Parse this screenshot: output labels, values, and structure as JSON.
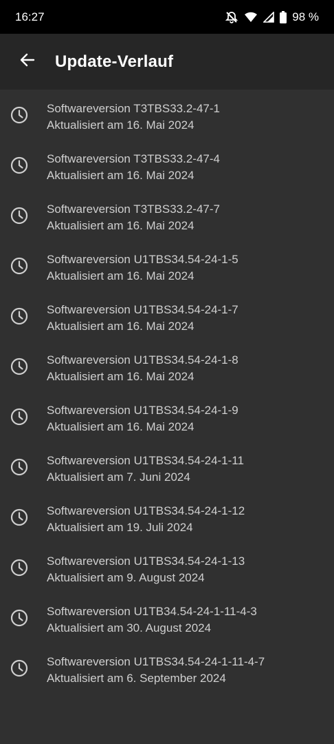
{
  "status_bar": {
    "time": "16:27",
    "battery_text": "98 %",
    "icons": [
      "mute-icon",
      "wifi-icon",
      "signal-icon",
      "battery-icon"
    ]
  },
  "app_bar": {
    "title": "Update-Verlauf",
    "back_icon": "arrow-back-icon"
  },
  "history": [
    {
      "version": "Softwareversion T3TBS33.2-47-1",
      "date": "Aktualisiert am 16. Mai 2024"
    },
    {
      "version": "Softwareversion T3TBS33.2-47-4",
      "date": "Aktualisiert am 16. Mai 2024"
    },
    {
      "version": "Softwareversion T3TBS33.2-47-7",
      "date": "Aktualisiert am 16. Mai 2024"
    },
    {
      "version": "Softwareversion U1TBS34.54-24-1-5",
      "date": "Aktualisiert am 16. Mai 2024"
    },
    {
      "version": "Softwareversion U1TBS34.54-24-1-7",
      "date": "Aktualisiert am 16. Mai 2024"
    },
    {
      "version": "Softwareversion U1TBS34.54-24-1-8",
      "date": "Aktualisiert am 16. Mai 2024"
    },
    {
      "version": "Softwareversion U1TBS34.54-24-1-9",
      "date": "Aktualisiert am 16. Mai 2024"
    },
    {
      "version": "Softwareversion U1TBS34.54-24-1-11",
      "date": "Aktualisiert am 7. Juni 2024"
    },
    {
      "version": "Softwareversion U1TBS34.54-24-1-12",
      "date": "Aktualisiert am 19. Juli 2024"
    },
    {
      "version": "Softwareversion U1TBS34.54-24-1-13",
      "date": "Aktualisiert am 9. August 2024"
    },
    {
      "version": "Softwareversion U1TB34.54-24-1-11-4-3",
      "date": "Aktualisiert am 30. August 2024"
    },
    {
      "version": "Softwareversion U1TBS34.54-24-1-11-4-7",
      "date": "Aktualisiert am 6. September 2024"
    }
  ],
  "colors": {
    "background": "#303030",
    "app_bar": "#262626",
    "status_bar": "#000000",
    "text": "#cfcfcf"
  }
}
